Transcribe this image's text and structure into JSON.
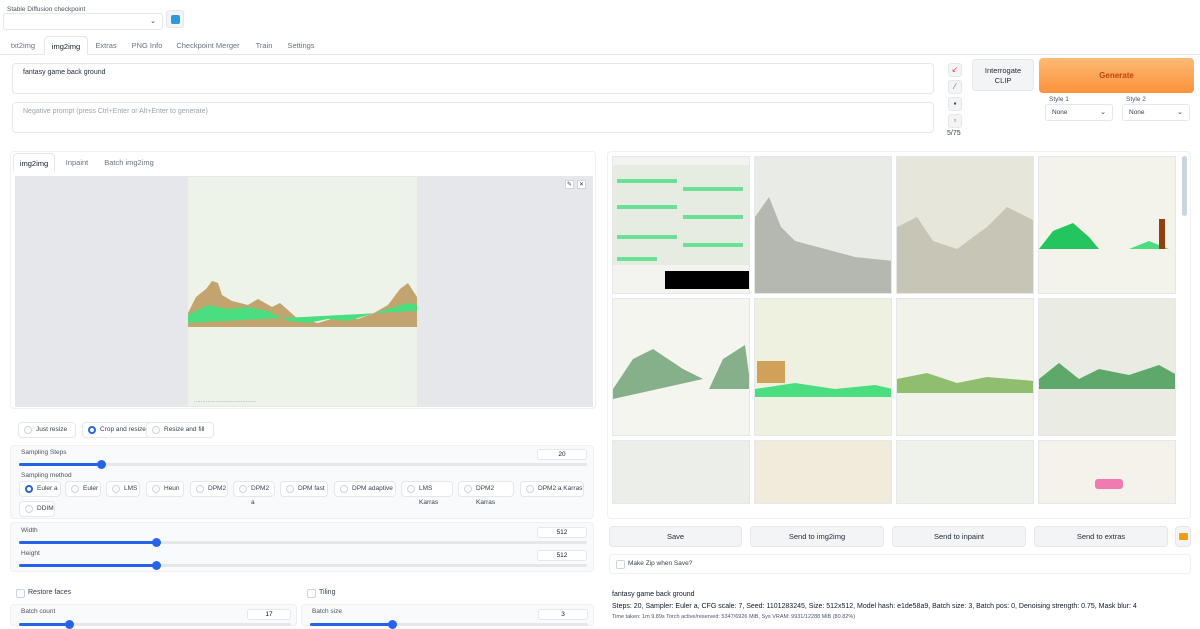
{
  "checkpoint": {
    "label": "Stable Diffusion checkpoint",
    "value": ""
  },
  "tabs": [
    "txt2img",
    "img2img",
    "Extras",
    "PNG Info",
    "Checkpoint Merger",
    "Train",
    "Settings"
  ],
  "prompt": {
    "value": "fantasy game back ground",
    "negative_placeholder": "Negative prompt (press Ctrl+Enter or Alt+Enter to generate)",
    "token_count": "5/75"
  },
  "interrogate_label": "Interrogate\nCLIP",
  "generate_label": "Generate",
  "styles": [
    {
      "label": "Style 1",
      "value": "None"
    },
    {
      "label": "Style 2",
      "value": "None"
    }
  ],
  "img_tabs": [
    "img2img",
    "Inpaint",
    "Batch img2img"
  ],
  "resize_modes": [
    "Just resize",
    "Crop and resize",
    "Resize and fill"
  ],
  "resize_selected": 1,
  "sampling_steps": {
    "label": "Sampling Steps",
    "value": "20",
    "fraction": 0.2
  },
  "sampling_method": {
    "label": "Sampling method",
    "options": [
      "Euler a",
      "Euler",
      "LMS",
      "Heun",
      "DPM2",
      "DPM2 a",
      "DPM fast",
      "DPM adaptive",
      "LMS Karras",
      "DPM2 Karras",
      "DPM2 a Karras",
      "DDIM"
    ],
    "selected": 0
  },
  "width": {
    "label": "Width",
    "value": "512",
    "fraction": 0.25
  },
  "height": {
    "label": "Height",
    "value": "512",
    "fraction": 0.25
  },
  "restore_faces": "Restore faces",
  "tiling": "Tiling",
  "batch_count": {
    "label": "Batch count",
    "value": "17",
    "fraction": 0.17
  },
  "batch_size": {
    "label": "Batch size",
    "value": "3",
    "fraction": 0.28
  },
  "actions": [
    "Save",
    "Send to img2img",
    "Send to inpaint",
    "Send to extras"
  ],
  "make_zip": "Make Zip when Save?",
  "info": {
    "prompt": "fantasy game back ground",
    "params": "Steps: 20, Sampler: Euler a, CFG scale: 7, Seed: 1101283245, Size: 512x512, Model hash: e1de58a9, Batch size: 3, Batch pos: 0, Denoising strength: 0.75, Mask blur: 4",
    "time": "Time taken: 1m 9.89s  Torch active/reserved: 5347/6926 MiB, Sys VRAM: 9931/12288 MiB (80.82%)"
  },
  "colors": {
    "accent": "#2563eb",
    "generate_from": "#fdba74",
    "generate_to": "#fb923c",
    "grass": "#4ade80"
  }
}
